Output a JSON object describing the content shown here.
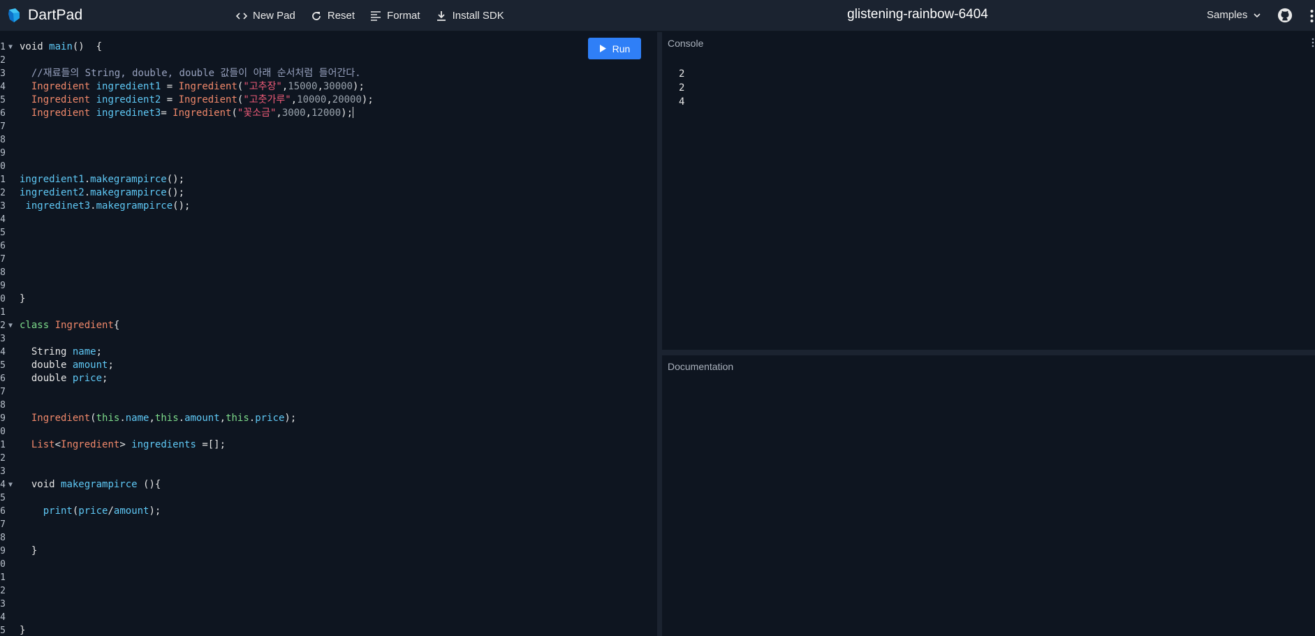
{
  "app": {
    "name": "DartPad",
    "pad_title": "glistening-rainbow-6404"
  },
  "toolbar": {
    "new_pad": "New Pad",
    "reset": "Reset",
    "format": "Format",
    "install_sdk": "Install SDK",
    "samples": "Samples"
  },
  "editor": {
    "run_label": "Run",
    "lines": [
      {
        "n": "1",
        "fold": true,
        "tokens": [
          [
            "kw-plain",
            "void "
          ],
          [
            "fn",
            "main"
          ],
          [
            "plain",
            "()  {"
          ]
        ]
      },
      {
        "n": "2",
        "tokens": []
      },
      {
        "n": "3",
        "tokens": [
          [
            "plain",
            "  "
          ],
          [
            "cmt",
            "//재료들의 String, double, double 값들이 아래 순서처럼 들어간다."
          ]
        ]
      },
      {
        "n": "4",
        "tokens": [
          [
            "plain",
            "  "
          ],
          [
            "cls",
            "Ingredient"
          ],
          [
            "plain",
            " "
          ],
          [
            "fn",
            "ingredient1"
          ],
          [
            "plain",
            " = "
          ],
          [
            "cls",
            "Ingredient"
          ],
          [
            "plain",
            "("
          ],
          [
            "str",
            "\"고추장\""
          ],
          [
            "plain",
            ","
          ],
          [
            "num",
            "15000"
          ],
          [
            "plain",
            ","
          ],
          [
            "num",
            "30000"
          ],
          [
            "plain",
            ");"
          ]
        ]
      },
      {
        "n": "5",
        "tokens": [
          [
            "plain",
            "  "
          ],
          [
            "cls",
            "Ingredient"
          ],
          [
            "plain",
            " "
          ],
          [
            "fn",
            "ingredient2"
          ],
          [
            "plain",
            " = "
          ],
          [
            "cls",
            "Ingredient"
          ],
          [
            "plain",
            "("
          ],
          [
            "str",
            "\"고춧가루\""
          ],
          [
            "plain",
            ","
          ],
          [
            "num",
            "10000"
          ],
          [
            "plain",
            ","
          ],
          [
            "num",
            "20000"
          ],
          [
            "plain",
            ");"
          ]
        ]
      },
      {
        "n": "6",
        "caret": true,
        "tokens": [
          [
            "plain",
            "  "
          ],
          [
            "cls",
            "Ingredient"
          ],
          [
            "plain",
            " "
          ],
          [
            "fn",
            "ingredinet3"
          ],
          [
            "plain",
            "= "
          ],
          [
            "cls",
            "Ingredient"
          ],
          [
            "plain",
            "("
          ],
          [
            "str",
            "\"꽃소금\""
          ],
          [
            "plain",
            ","
          ],
          [
            "num",
            "3000"
          ],
          [
            "plain",
            ","
          ],
          [
            "num",
            "12000"
          ],
          [
            "plain",
            ");"
          ]
        ]
      },
      {
        "n": "7",
        "tokens": []
      },
      {
        "n": "8",
        "tokens": []
      },
      {
        "n": "9",
        "tokens": []
      },
      {
        "n": "0",
        "tokens": []
      },
      {
        "n": "1",
        "tokens": [
          [
            "fn",
            "ingredient1"
          ],
          [
            "plain",
            "."
          ],
          [
            "fn",
            "makegrampirce"
          ],
          [
            "plain",
            "();"
          ]
        ]
      },
      {
        "n": "2",
        "tokens": [
          [
            "fn",
            "ingredient2"
          ],
          [
            "plain",
            "."
          ],
          [
            "fn",
            "makegrampirce"
          ],
          [
            "plain",
            "();"
          ]
        ]
      },
      {
        "n": "3",
        "tokens": [
          [
            "plain",
            " "
          ],
          [
            "fn",
            "ingredinet3"
          ],
          [
            "plain",
            "."
          ],
          [
            "fn",
            "makegrampirce"
          ],
          [
            "plain",
            "();"
          ]
        ]
      },
      {
        "n": "4",
        "tokens": []
      },
      {
        "n": "5",
        "tokens": []
      },
      {
        "n": "6",
        "tokens": []
      },
      {
        "n": "7",
        "tokens": []
      },
      {
        "n": "8",
        "tokens": []
      },
      {
        "n": "9",
        "tokens": []
      },
      {
        "n": "0",
        "tokens": [
          [
            "plain",
            "}"
          ]
        ]
      },
      {
        "n": "1",
        "tokens": []
      },
      {
        "n": "2",
        "fold": true,
        "tokens": [
          [
            "kw",
            "class"
          ],
          [
            "plain",
            " "
          ],
          [
            "cls",
            "Ingredient"
          ],
          [
            "plain",
            "{"
          ]
        ]
      },
      {
        "n": "3",
        "tokens": []
      },
      {
        "n": "4",
        "tokens": [
          [
            "plain",
            "  String "
          ],
          [
            "fn",
            "name"
          ],
          [
            "plain",
            ";"
          ]
        ]
      },
      {
        "n": "5",
        "tokens": [
          [
            "plain",
            "  double "
          ],
          [
            "fn",
            "amount"
          ],
          [
            "plain",
            ";"
          ]
        ]
      },
      {
        "n": "6",
        "tokens": [
          [
            "plain",
            "  double "
          ],
          [
            "fn",
            "price"
          ],
          [
            "plain",
            ";"
          ]
        ]
      },
      {
        "n": "7",
        "tokens": []
      },
      {
        "n": "8",
        "tokens": []
      },
      {
        "n": "9",
        "tokens": [
          [
            "plain",
            "  "
          ],
          [
            "cls",
            "Ingredient"
          ],
          [
            "plain",
            "("
          ],
          [
            "this",
            "this"
          ],
          [
            "plain",
            "."
          ],
          [
            "fn",
            "name"
          ],
          [
            "plain",
            ","
          ],
          [
            "this",
            "this"
          ],
          [
            "plain",
            "."
          ],
          [
            "fn",
            "amount"
          ],
          [
            "plain",
            ","
          ],
          [
            "this",
            "this"
          ],
          [
            "plain",
            "."
          ],
          [
            "fn",
            "price"
          ],
          [
            "plain",
            ");"
          ]
        ]
      },
      {
        "n": "0",
        "tokens": []
      },
      {
        "n": "1",
        "tokens": [
          [
            "plain",
            "  "
          ],
          [
            "cls",
            "List"
          ],
          [
            "plain",
            "<"
          ],
          [
            "cls",
            "Ingredient"
          ],
          [
            "plain",
            "> "
          ],
          [
            "fn",
            "ingredients"
          ],
          [
            "plain",
            " =[];"
          ]
        ]
      },
      {
        "n": "2",
        "tokens": []
      },
      {
        "n": "3",
        "tokens": []
      },
      {
        "n": "4",
        "fold": true,
        "tokens": [
          [
            "plain",
            "  void "
          ],
          [
            "fn",
            "makegrampirce"
          ],
          [
            "plain",
            " (){"
          ]
        ]
      },
      {
        "n": "5",
        "tokens": []
      },
      {
        "n": "6",
        "tokens": [
          [
            "plain",
            "    "
          ],
          [
            "fn",
            "print"
          ],
          [
            "plain",
            "("
          ],
          [
            "fn",
            "price"
          ],
          [
            "plain",
            "/"
          ],
          [
            "fn",
            "amount"
          ],
          [
            "plain",
            ");"
          ]
        ]
      },
      {
        "n": "7",
        "tokens": []
      },
      {
        "n": "8",
        "tokens": []
      },
      {
        "n": "9",
        "tokens": [
          [
            "plain",
            "  }"
          ]
        ]
      },
      {
        "n": "0",
        "tokens": []
      },
      {
        "n": "1",
        "tokens": []
      },
      {
        "n": "2",
        "tokens": []
      },
      {
        "n": "3",
        "tokens": []
      },
      {
        "n": "4",
        "tokens": []
      },
      {
        "n": "5",
        "tokens": [
          [
            "plain",
            "}"
          ]
        ]
      }
    ]
  },
  "console": {
    "label": "Console",
    "output": [
      "2",
      "2",
      "4"
    ]
  },
  "documentation": {
    "label": "Documentation"
  },
  "colors": {
    "accent": "#2f7ff7",
    "background": "#0e1520",
    "topbar": "#1b2330"
  }
}
